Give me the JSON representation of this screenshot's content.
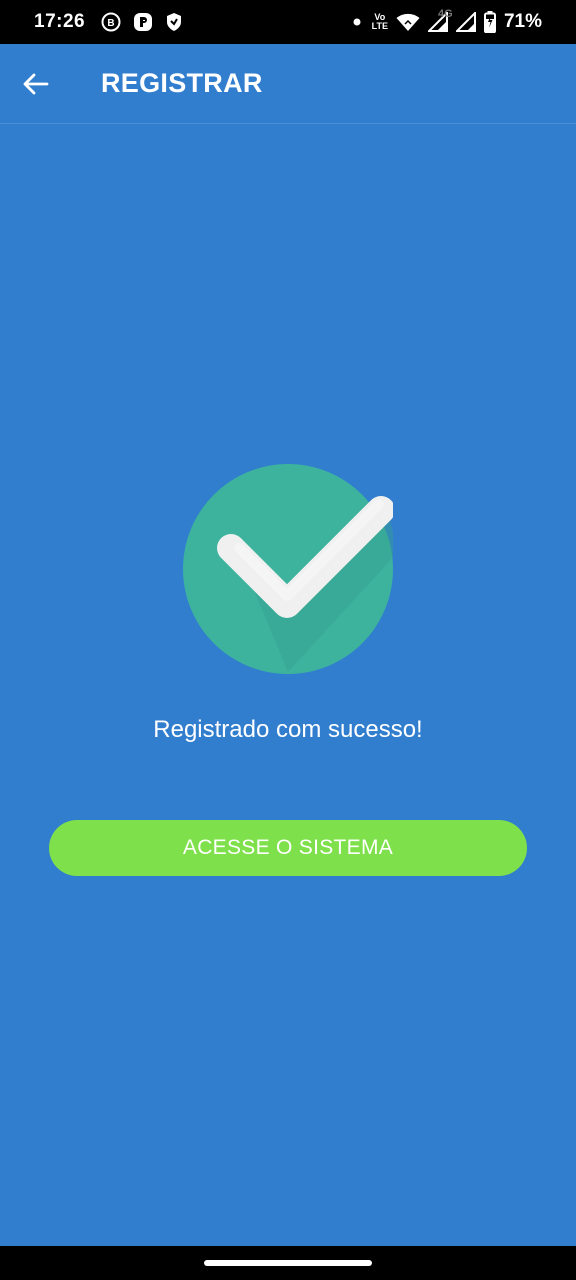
{
  "status_bar": {
    "time": "17:26",
    "battery_percent": "71%",
    "lte_top": "Vo",
    "lte_bottom": "LTE",
    "network_label": "4G",
    "notification_icons": [
      "b-circle-icon",
      "p-square-icon",
      "shield-icon"
    ],
    "system_icons": [
      "dot-icon",
      "volte-icon",
      "wifi-icon",
      "signal-icon",
      "signal-4g-icon",
      "battery-charging-icon"
    ]
  },
  "app_bar": {
    "title": "REGISTRAR",
    "back_icon": "arrow-left-icon"
  },
  "main": {
    "success_icon": "check-circle-icon",
    "success_message": "Registrado com sucesso!",
    "access_button_label": "ACESSE O SISTEMA"
  },
  "colors": {
    "background": "#317ECE",
    "badge_circle": "#3DB39E",
    "checkmark": "#F0F0F0",
    "button": "#7EE04A",
    "text": "#FFFFFF"
  }
}
